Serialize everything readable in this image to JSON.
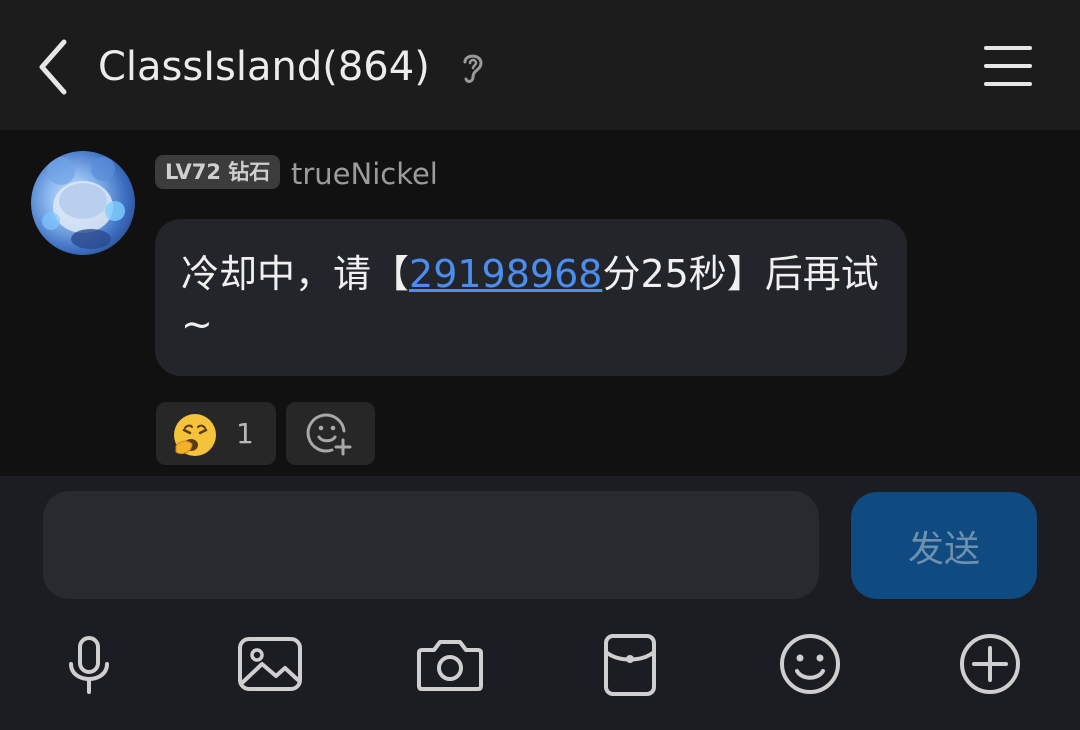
{
  "header": {
    "title": "ClassIsland(864)",
    "back_icon": "chevron-left-icon",
    "ear_icon": "ear-icon",
    "menu_icon": "hamburger-menu-icon"
  },
  "message": {
    "level_badge": "LV72 钻石",
    "username": "trueNickel",
    "text_before": "冷却中，请【",
    "link_text": "29198968",
    "text_after": "分25秒】后再试~",
    "link_color": "#4c8df0"
  },
  "reactions": [
    {
      "emoji": "yawning-face-icon",
      "count": "1"
    }
  ],
  "add_reaction_icon": "add-emoji-icon",
  "input": {
    "value": "",
    "placeholder": "",
    "send_label": "发送",
    "send_color": "#0f4a80"
  },
  "toolbar": [
    {
      "name": "microphone-icon"
    },
    {
      "name": "image-icon"
    },
    {
      "name": "camera-icon"
    },
    {
      "name": "red-packet-icon"
    },
    {
      "name": "emoji-icon"
    },
    {
      "name": "plus-circle-icon"
    }
  ]
}
